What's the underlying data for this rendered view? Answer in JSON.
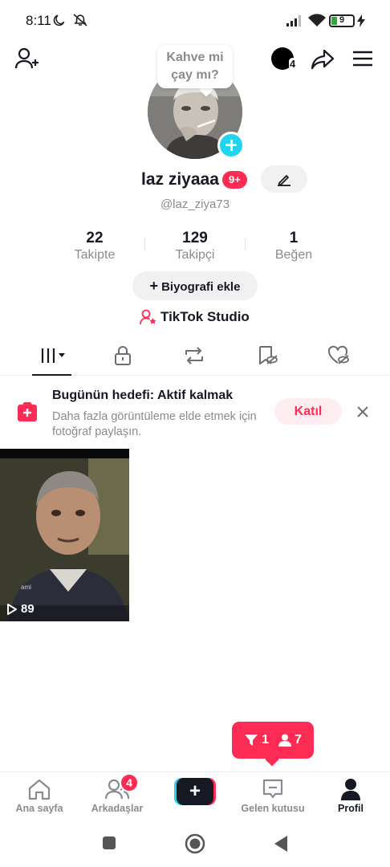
{
  "status_bar": {
    "time": "8:11",
    "battery": "9"
  },
  "header": {
    "story_count": "4"
  },
  "profile": {
    "bubble_text_1": "Kahve mi",
    "bubble_text_2": "çay mı?",
    "name": "laz ziyaaa",
    "name_badge": "9+",
    "handle": "@laz_ziya73"
  },
  "stats": [
    {
      "value": "22",
      "label": "Takipte"
    },
    {
      "value": "129",
      "label": "Takipçi"
    },
    {
      "value": "1",
      "label": "Beğen"
    }
  ],
  "bio_button": {
    "plus": "+",
    "label": "Biyografi ekle"
  },
  "studio_link": "TikTok Studio",
  "goal_banner": {
    "title": "Bugünün hedefi: Aktif kalmak",
    "description": "Daha fazla görüntüleme elde etmek için fotoğraf paylaşın.",
    "join_label": "Katıl"
  },
  "videos": [
    {
      "views": "89",
      "watermark": "ami"
    }
  ],
  "notification_popup": {
    "likes": "1",
    "followers": "7"
  },
  "bottom_nav": {
    "home": "Ana sayfa",
    "friends": "Arkadaşlar",
    "friends_badge": "4",
    "create": "+",
    "inbox": "Gelen kutusu",
    "profile": "Profil"
  },
  "colors": {
    "accent": "#fe2c55",
    "cyan": "#20d5ec",
    "text": "#161823",
    "muted": "#8a8b91"
  }
}
